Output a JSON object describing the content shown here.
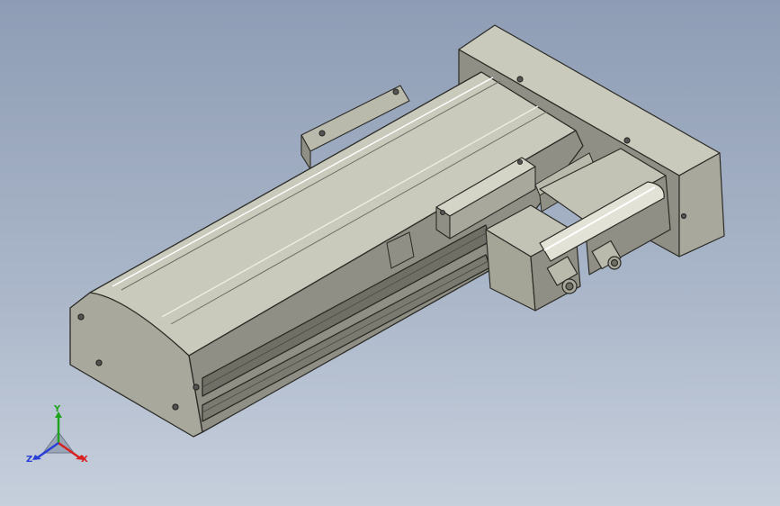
{
  "viewport": {
    "background_top": "#8e9db5",
    "background_bottom": "#c6cfdc"
  },
  "model": {
    "icon": "linear-actuator-model",
    "colors": {
      "top": "#c9c9bc",
      "front": "#8f8f85",
      "side": "#a8a89c",
      "dark": "#6f6f66",
      "edge": "#2b2b26",
      "motor": "#a4a497"
    }
  },
  "triad": {
    "icon": "coordinate-triad-icon",
    "x_label": "X",
    "y_label": "Y",
    "z_label": "Z",
    "x_color": "#d92020",
    "y_color": "#1fa31f",
    "z_color": "#2a3fd6"
  }
}
